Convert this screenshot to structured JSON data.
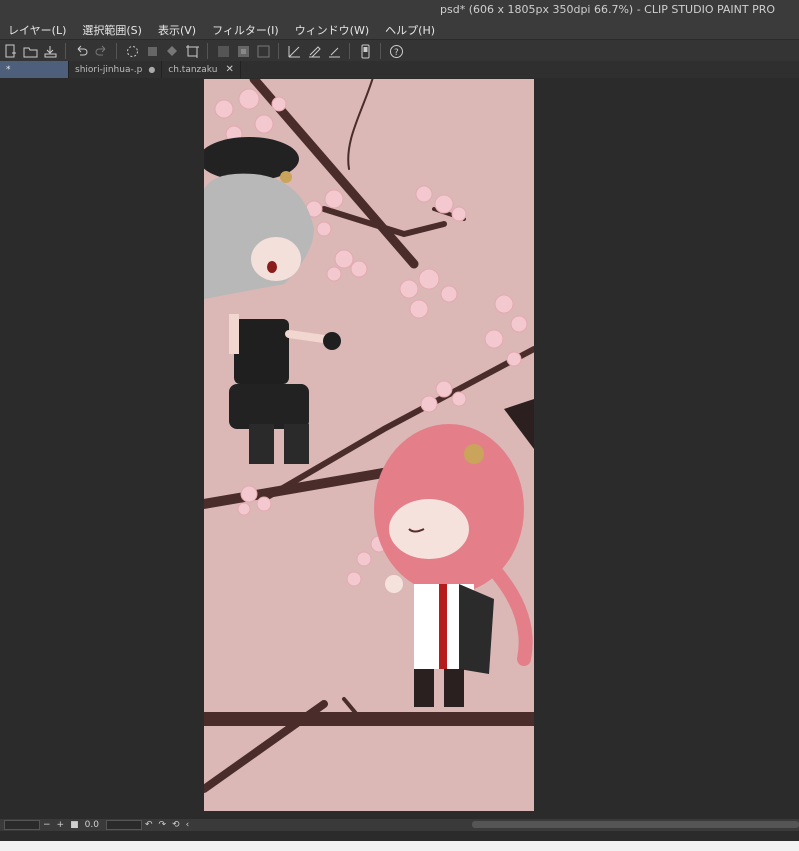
{
  "window": {
    "title": "psd* (606 x 1805px 350dpi 66.7%)  - CLIP STUDIO PAINT PRO"
  },
  "menu": {
    "items": [
      {
        "label": "レイヤー(L)"
      },
      {
        "label": "選択範囲(S)"
      },
      {
        "label": "表示(V)"
      },
      {
        "label": "フィルター(I)"
      },
      {
        "label": "ウィンドウ(W)"
      },
      {
        "label": "ヘルプ(H)"
      }
    ]
  },
  "toolbar": {
    "icons": [
      "new-file-icon",
      "open-folder-icon",
      "save-icon",
      "undo-icon",
      "redo-icon",
      "loading-icon",
      "clear-icon",
      "fill-icon",
      "transform-icon",
      "hide-outside-icon",
      "invert-selection-icon",
      "selection-border-icon",
      "ruler-icon",
      "pen-icon",
      "ruler2-icon",
      "device-icon",
      "help-icon"
    ]
  },
  "tabs": [
    {
      "label": "*",
      "active": true
    },
    {
      "label": "shiori-jinhua-.p",
      "active": false
    },
    {
      "label": "ch.tanzaku",
      "active": false
    }
  ],
  "status": {
    "zoom": "0.0",
    "minus": "−",
    "plus": "+"
  },
  "colors": {
    "canvas_bg": "#dbb8b6",
    "branch": "#4a2c2a",
    "blossom": "#f3c9cf",
    "active_tab": "#4e5f7c"
  }
}
